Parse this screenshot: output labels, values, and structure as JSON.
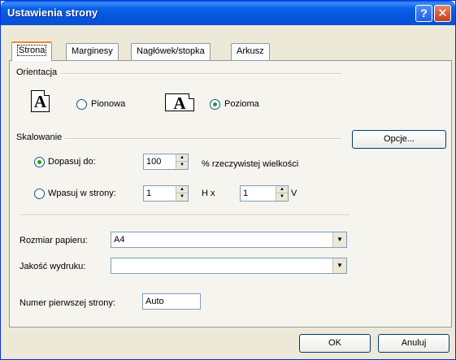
{
  "window": {
    "title": "Ustawienia strony",
    "help_glyph": "?",
    "close_glyph": "✕"
  },
  "tabs": [
    {
      "label": "Strona"
    },
    {
      "label": "Marginesy"
    },
    {
      "label": "Nagłówek/stopka"
    },
    {
      "label": "Arkusz"
    }
  ],
  "orientation": {
    "group_label": "Orientacja",
    "icon_letter": "A",
    "portrait_label": "Pionowa",
    "landscape_label": "Pozioma",
    "selected": "landscape"
  },
  "scaling": {
    "group_label": "Skalowanie",
    "adjust_label": "Dopasuj do:",
    "adjust_value": "100",
    "adjust_suffix": "% rzeczywistej wielkości",
    "fit_label": "Wpasuj w strony:",
    "fit_wide_value": "1",
    "fit_wide_suffix": "H x",
    "fit_tall_value": "1",
    "fit_tall_suffix": "V",
    "selected": "adjust"
  },
  "options_button": "Opcje...",
  "paper": {
    "label": "Rozmiar papieru:",
    "value": "A4"
  },
  "quality": {
    "label": "Jakość wydruku:",
    "value": ""
  },
  "first_page": {
    "label": "Numer pierwszej strony:",
    "value": "Auto"
  },
  "buttons": {
    "ok": "OK",
    "cancel": "Anuluj"
  }
}
